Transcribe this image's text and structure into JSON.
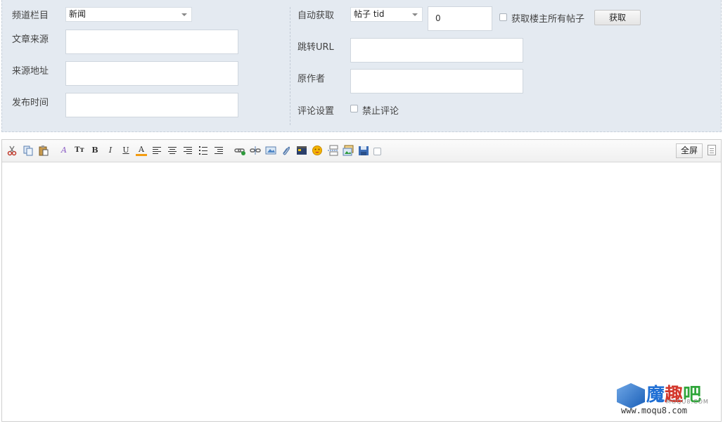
{
  "form": {
    "left": {
      "channel_label": "频道栏目",
      "channel_value": "新闻",
      "source_label": "文章来源",
      "source_value": "",
      "source_url_label": "来源地址",
      "source_url_value": "",
      "publish_time_label": "发布时间",
      "publish_time_value": ""
    },
    "right": {
      "auto_fetch_label": "自动获取",
      "fetch_type_value": "帖子 tid",
      "tid_value": "0",
      "all_posts_label": "获取楼主所有帖子",
      "fetch_button": "获取",
      "redirect_url_label": "跳转URL",
      "redirect_url_value": "",
      "author_label": "原作者",
      "author_value": "",
      "comment_label": "评论设置",
      "disable_comment_label": "禁止评论"
    }
  },
  "editor": {
    "fullscreen_label": "全屏",
    "toolbar_icons": [
      "cut-icon",
      "copy-icon",
      "paste-icon",
      "font-face-icon",
      "font-size-icon",
      "bold-icon",
      "italic-icon",
      "underline-icon",
      "font-color-icon",
      "align-left-icon",
      "align-center-icon",
      "align-right-icon",
      "ordered-list-icon",
      "unordered-list-icon",
      "link-icon",
      "unlink-icon",
      "image-icon",
      "attachment-icon",
      "video-icon",
      "smiley-icon",
      "page-break-icon",
      "insert-table-icon",
      "save-icon",
      "checkbox"
    ],
    "glyphs": {
      "bold": "B",
      "italic": "I",
      "underline": "U",
      "font_color": "A",
      "font_face": "A",
      "font_size": "Tт"
    }
  },
  "watermark": {
    "mo": "魔",
    "qu": "趣",
    "ba": "吧",
    "sub": "MOQU8.COM",
    "url": "www.moqu8.com"
  },
  "colors": {
    "panel_bg": "#e4eaf1",
    "brand_blue": "#1f6fd4",
    "brand_red": "#d3372b",
    "brand_green": "#2fa53a"
  }
}
